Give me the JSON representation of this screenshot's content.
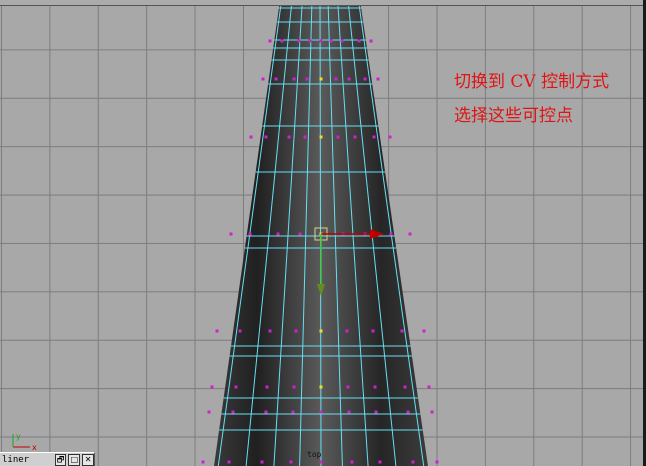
{
  "annotation": {
    "line1": "切换到 CV 控制方式",
    "line2": "选择这些可控点"
  },
  "viewport": {
    "camera_label": "top"
  },
  "outliner": {
    "title": "liner",
    "restore_glyph": "🗗",
    "maximize_glyph": "□",
    "close_glyph": "✕"
  },
  "axis": {
    "x_label": "x",
    "y_label": "y"
  },
  "colors": {
    "grid_bg": "#a8a8a8",
    "grid_line": "#7d7d7d",
    "mesh_wire": "#66e0f2",
    "cv_point": "#d020d0",
    "selected_cv": "#f0e020",
    "annotation_text": "#e01414"
  },
  "icons": [
    "restore-icon",
    "maximize-icon",
    "close-icon",
    "axis-gizmo-icon",
    "move-manipulator-icon"
  ]
}
